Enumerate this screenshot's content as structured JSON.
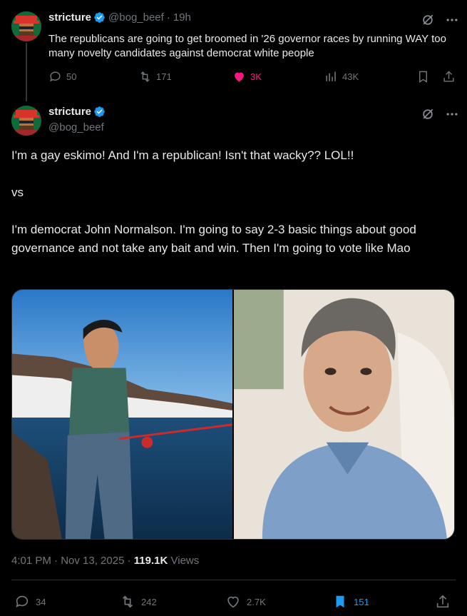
{
  "parent_tweet": {
    "display_name": "stricture",
    "handle": "@bog_beef",
    "time": "19h",
    "text": "The republicans are going to get broomed in '26 governor races by running WAY too many novelty candidates against democrat white people",
    "replies": "50",
    "reposts": "171",
    "likes": "3K",
    "views": "43K"
  },
  "main_tweet": {
    "display_name": "stricture",
    "handle": "@bog_beef",
    "paragraphs": [
      "I'm a gay eskimo! And I'm a republican! Isn't that wacky?? LOL!!",
      "vs",
      "I'm democrat John Normalson. I'm going to say 2-3 basic things about good governance and not take any bait and win. Then I'm going to vote like Mao"
    ],
    "timestamp": "4:01 PM · Nov 13, 2025",
    "views_count": "119.1K",
    "views_label": "Views",
    "replies": "34",
    "reposts": "242",
    "likes": "2.7K",
    "bookmarks": "151"
  },
  "colors": {
    "like_pink": "#f91880",
    "bookmark_blue": "#1d9bf0",
    "verified_blue": "#1d9bf0",
    "muted": "#71767b"
  }
}
